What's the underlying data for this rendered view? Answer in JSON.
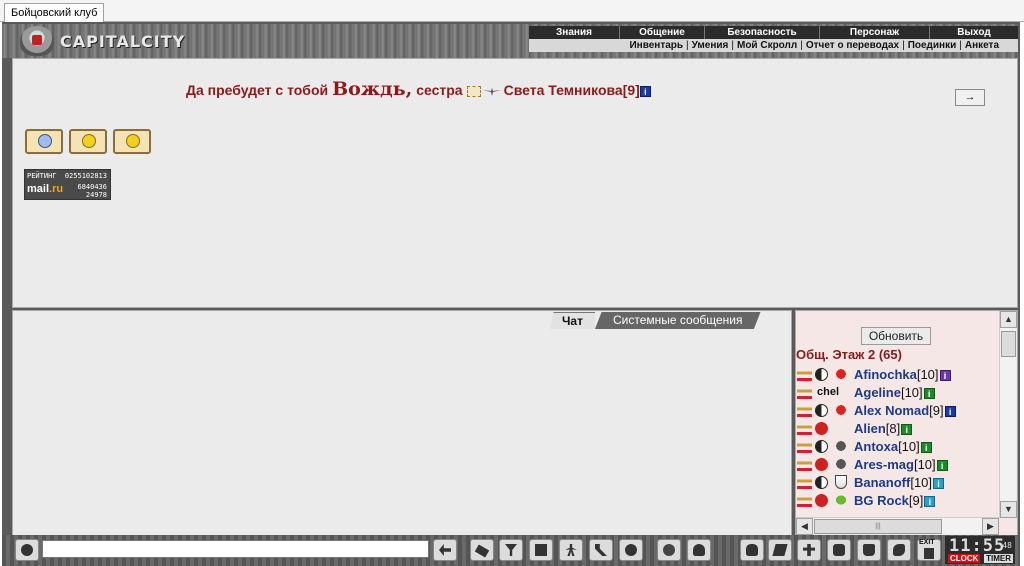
{
  "browser": {
    "tab_title": "Бойцовский клуб"
  },
  "header": {
    "logo_text": "CAPITALCITY",
    "menu_top": [
      "Знания",
      "Общение",
      "Безопасность",
      "Персонаж",
      "Выход"
    ],
    "menu_bottom": [
      "Инвентарь",
      "Умения",
      "Мой Скролл",
      "Отчет о переводах",
      "Поединки",
      "Анкета"
    ]
  },
  "greeting": {
    "prefix": "Да пребудет с тобой",
    "title": "Вождь,",
    "relation": "сестра",
    "name": "Света Темникова",
    "level": "[9]",
    "info": "i"
  },
  "main": {
    "arrow_button": "→",
    "counter": {
      "label": "РЕЙТИНГ",
      "brand_a": "mail",
      "brand_b": ".ru",
      "v1": "0255102813",
      "v2": "6840436",
      "v3": "24978"
    }
  },
  "chat": {
    "tabs": [
      "Чат",
      "Системные сообщения"
    ],
    "input_value": ""
  },
  "online": {
    "refresh_label": "Обновить",
    "floor_title": "Общ. Этаж 2 (65)",
    "users": [
      {
        "name": "Afinochka",
        "level": "[10]",
        "align": "yin",
        "clan": "red",
        "info": "purple"
      },
      {
        "name": "Ageline",
        "level": "[10]",
        "align": "chel",
        "clan": "none",
        "info": "green"
      },
      {
        "name": "Alex Nomad",
        "level": "[9]",
        "align": "yin",
        "clan": "red",
        "info": "blue"
      },
      {
        "name": "Alien",
        "level": "[8]",
        "align": "cross",
        "clan": "none",
        "info": "green"
      },
      {
        "name": "Antoxa",
        "level": "[10]",
        "align": "yin",
        "clan": "gray",
        "info": "green"
      },
      {
        "name": "Ares-mag",
        "level": "[10]",
        "align": "cross",
        "clan": "gray",
        "info": "green"
      },
      {
        "name": "Bananoff",
        "level": "[10]",
        "align": "yin",
        "clan": "shield",
        "info": "cyan"
      },
      {
        "name": "BG Rock",
        "level": "[9]",
        "align": "cross",
        "clan": "green",
        "info": "cyan"
      }
    ],
    "hscroll_grip": "|||"
  },
  "footer": {
    "clock_time": "11:55",
    "clock_seconds": "48",
    "clock_label": "CLOCK",
    "timer_label": "TIMER",
    "exit_label": "EXIT"
  }
}
